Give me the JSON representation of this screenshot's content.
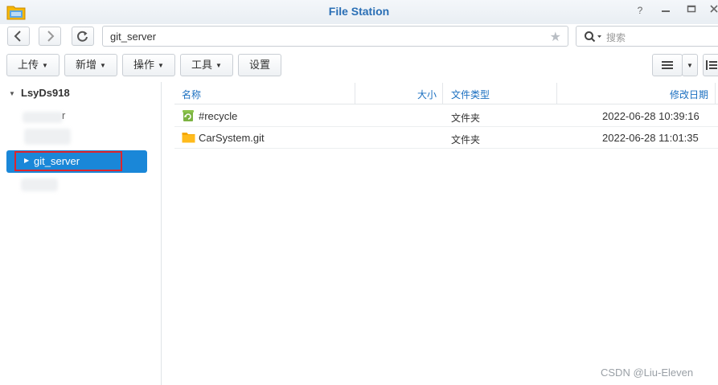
{
  "window": {
    "title": "File Station"
  },
  "toolbar": {
    "path": "git_server",
    "search_placeholder": "搜索",
    "buttons": {
      "upload": "上传",
      "new": "新增",
      "action": "操作",
      "tools": "工具",
      "settings": "设置"
    }
  },
  "sidebar": {
    "root": "LsyDs918",
    "partial_item_fragment": "r",
    "selected_item": "git_server"
  },
  "file_list": {
    "columns": {
      "name": "名称",
      "size": "大小",
      "type": "文件类型",
      "modified": "修改日期"
    },
    "rows": [
      {
        "name": "#recycle",
        "size": "",
        "type": "文件夹",
        "modified": "2022-06-28 10:39:16",
        "icon": "recycle-folder-icon"
      },
      {
        "name": "CarSystem.git",
        "size": "",
        "type": "文件夹",
        "modified": "2022-06-28 11:01:35",
        "icon": "folder-icon"
      }
    ]
  },
  "watermark": "CSDN @Liu-Eleven",
  "colors": {
    "title": "#2a6fb5",
    "accent": "#1a87d8",
    "highlight": "#e0242b",
    "header_text": "#1a6fc0",
    "folder": "#f5a700",
    "recycle": "#7cb342"
  }
}
